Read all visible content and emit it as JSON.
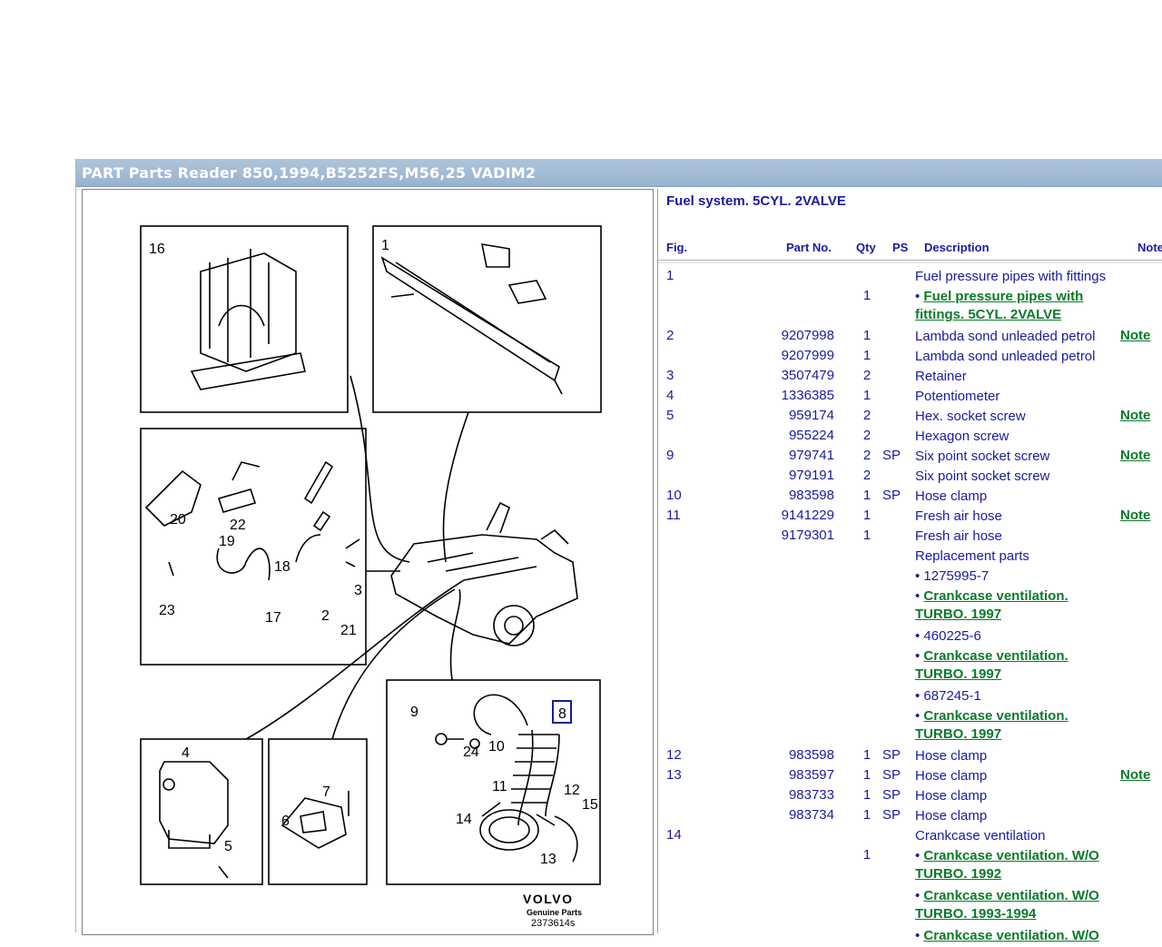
{
  "window": {
    "title": "PART Parts Reader 850,1994,B5252FS,M56,25 VADIM2"
  },
  "diagram": {
    "callouts": [
      "16",
      "1",
      "20",
      "22",
      "19",
      "18",
      "23",
      "17",
      "3",
      "2",
      "21",
      "4",
      "5",
      "7",
      "6",
      "9",
      "8",
      "24",
      "10",
      "11",
      "12",
      "14",
      "15",
      "13"
    ],
    "brand": "VOLVO",
    "brand_sub": "Genuine Parts",
    "drawing_no": "2373614s"
  },
  "section": {
    "title": "Fuel system. 5CYL. 2VALVE"
  },
  "columns": {
    "fig": "Fig.",
    "part": "Part No.",
    "qty": "Qty",
    "ps": "PS",
    "desc": "Description",
    "note": "Note"
  },
  "rows": [
    {
      "fig": "1",
      "pn": "",
      "qty": "",
      "ps": "",
      "desc": "Fuel pressure pipes with fittings",
      "note": ""
    },
    {
      "fig": "",
      "pn": "",
      "qty": "1",
      "ps": "",
      "link": "Fuel pressure pipes with fittings. 5CYL. 2VALVE",
      "note": "",
      "h": 2
    },
    {
      "fig": "2",
      "pn": "9207998",
      "qty": "1",
      "ps": "",
      "desc": "Lambda sond unleaded petrol",
      "note": "Note"
    },
    {
      "fig": "",
      "pn": "9207999",
      "qty": "1",
      "ps": "",
      "desc": "Lambda sond unleaded petrol",
      "note": ""
    },
    {
      "fig": "3",
      "pn": "3507479",
      "qty": "2",
      "ps": "",
      "desc": "Retainer",
      "note": ""
    },
    {
      "fig": "4",
      "pn": "1336385",
      "qty": "1",
      "ps": "",
      "desc": "Potentiometer",
      "note": ""
    },
    {
      "fig": "5",
      "pn": "959174",
      "qty": "2",
      "ps": "",
      "desc": "Hex. socket screw",
      "note": "Note"
    },
    {
      "fig": "",
      "pn": "955224",
      "qty": "2",
      "ps": "",
      "desc": "Hexagon screw",
      "note": ""
    },
    {
      "fig": "9",
      "pn": "979741",
      "qty": "2",
      "ps": "SP",
      "desc": "Six point socket screw",
      "note": "Note"
    },
    {
      "fig": "",
      "pn": "979191",
      "qty": "2",
      "ps": "",
      "desc": "Six point socket screw",
      "note": ""
    },
    {
      "fig": "10",
      "pn": "983598",
      "qty": "1",
      "ps": "SP",
      "desc": "Hose clamp",
      "note": ""
    },
    {
      "fig": "11",
      "pn": "9141229",
      "qty": "1",
      "ps": "",
      "desc": "Fresh air hose",
      "note": "Note"
    },
    {
      "fig": "",
      "pn": "9179301",
      "qty": "1",
      "ps": "",
      "desc": "Fresh air hose",
      "note": ""
    },
    {
      "fig": "",
      "pn": "",
      "qty": "",
      "ps": "",
      "desc": "Replacement parts",
      "note": ""
    },
    {
      "fig": "",
      "pn": "",
      "qty": "",
      "ps": "",
      "bullet": "1275995-7",
      "note": ""
    },
    {
      "fig": "",
      "pn": "",
      "qty": "",
      "ps": "",
      "link": "Crankcase ventilation. TURBO. 1997",
      "note": "",
      "h": 2
    },
    {
      "fig": "",
      "pn": "",
      "qty": "",
      "ps": "",
      "bullet": "460225-6",
      "note": ""
    },
    {
      "fig": "",
      "pn": "",
      "qty": "",
      "ps": "",
      "link": "Crankcase ventilation. TURBO. 1997",
      "note": "",
      "h": 2
    },
    {
      "fig": "",
      "pn": "",
      "qty": "",
      "ps": "",
      "bullet": "687245-1",
      "note": ""
    },
    {
      "fig": "",
      "pn": "",
      "qty": "",
      "ps": "",
      "link": "Crankcase ventilation. TURBO. 1997",
      "note": "",
      "h": 2
    },
    {
      "fig": "12",
      "pn": "983598",
      "qty": "1",
      "ps": "SP",
      "desc": "Hose clamp",
      "note": ""
    },
    {
      "fig": "13",
      "pn": "983597",
      "qty": "1",
      "ps": "SP",
      "desc": "Hose clamp",
      "note": "Note"
    },
    {
      "fig": "",
      "pn": "983733",
      "qty": "1",
      "ps": "SP",
      "desc": "Hose clamp",
      "note": ""
    },
    {
      "fig": "",
      "pn": "983734",
      "qty": "1",
      "ps": "SP",
      "desc": "Hose clamp",
      "note": ""
    },
    {
      "fig": "14",
      "pn": "",
      "qty": "",
      "ps": "",
      "desc": "Crankcase ventilation",
      "note": ""
    },
    {
      "fig": "",
      "pn": "",
      "qty": "1",
      "ps": "",
      "link": "Crankcase ventilation. W/O TURBO. 1992",
      "note": "",
      "h": 2
    },
    {
      "fig": "",
      "pn": "",
      "qty": "",
      "ps": "",
      "link": "Crankcase ventilation. W/O TURBO. 1993-1994",
      "note": "",
      "h": 2
    },
    {
      "fig": "",
      "pn": "",
      "qty": "",
      "ps": "",
      "link": "Crankcase ventilation. W/O",
      "note": ""
    }
  ]
}
